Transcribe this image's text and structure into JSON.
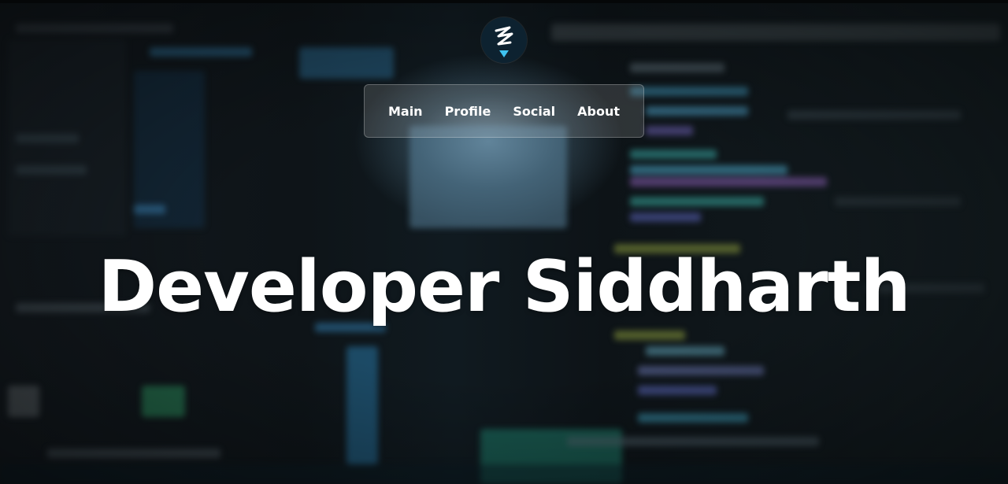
{
  "site": {
    "logo_icon": "stylized-s-logo-icon",
    "accent": "#3fc3f0"
  },
  "nav": {
    "items": [
      {
        "label": "Main"
      },
      {
        "label": "Profile"
      },
      {
        "label": "Social"
      },
      {
        "label": "About"
      }
    ]
  },
  "hero": {
    "title": "Developer Siddharth",
    "background": "blurred-code-editor-photo"
  }
}
